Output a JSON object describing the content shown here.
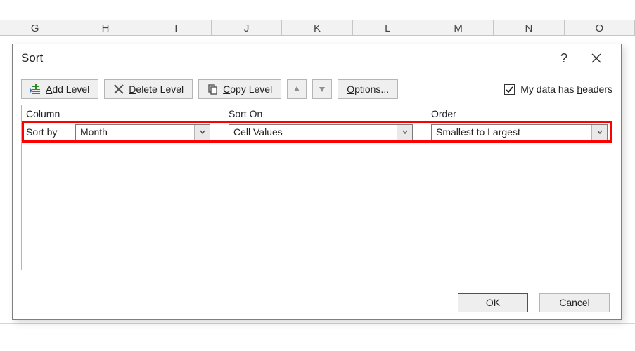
{
  "sheet": {
    "cols": [
      "G",
      "H",
      "I",
      "J",
      "K",
      "L",
      "M",
      "N",
      "O"
    ]
  },
  "dialog": {
    "title": "Sort",
    "help_tooltip": "?",
    "toolbar": {
      "add_prefix": "A",
      "add_rest": "dd Level",
      "delete_prefix": "D",
      "delete_rest": "elete Level",
      "copy_prefix": "C",
      "copy_rest": "opy Level",
      "options_prefix": "O",
      "options_rest": "ptions...",
      "headers_prefix": "My data has ",
      "headers_underline": "h",
      "headers_rest": "eaders",
      "headers_checked": true
    },
    "columns": {
      "col_header": "Column",
      "sorton_header": "Sort On",
      "order_header": "Order"
    },
    "row": {
      "label": "Sort by",
      "column_value": "Month",
      "sorton_value": "Cell Values",
      "order_value": "Smallest to Largest"
    },
    "footer": {
      "ok": "OK",
      "cancel": "Cancel"
    }
  }
}
